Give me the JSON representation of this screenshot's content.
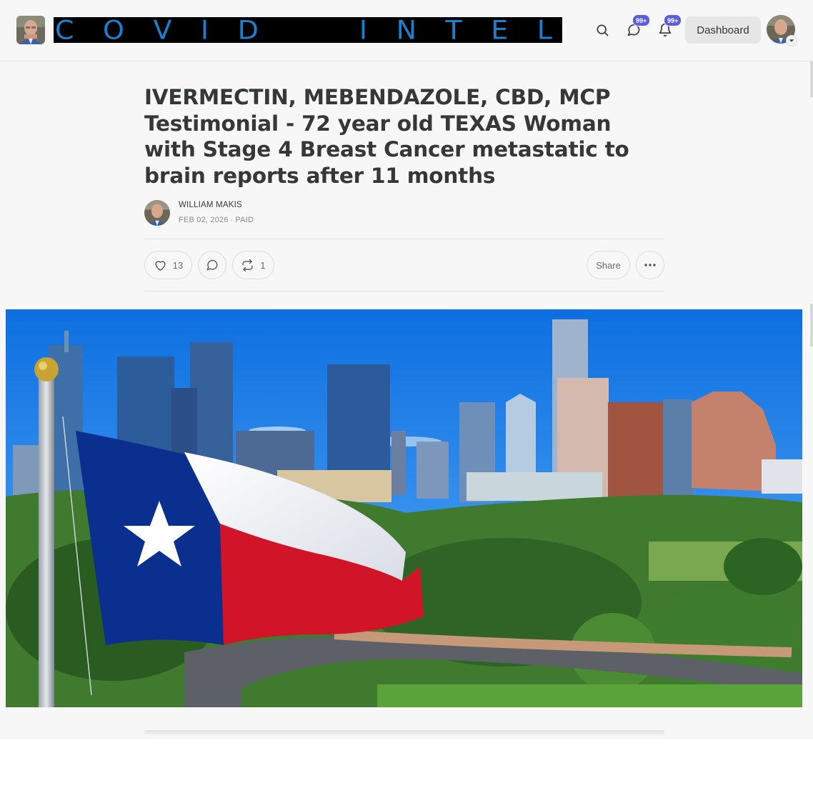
{
  "header": {
    "banner_letters": [
      "C",
      "O",
      "V",
      "I",
      "D",
      "",
      "I",
      "N",
      "T",
      "E",
      "L"
    ],
    "chat_badge": "99+",
    "notifications_badge": "99+",
    "dashboard_label": "Dashboard"
  },
  "post": {
    "title": "IVERMECTIN, MEBENDAZOLE, CBD, MCP Testimonial - 72 year old TEXAS Woman with Stage 4 Breast Cancer metastatic to brain reports after 11 months",
    "author": "WILLIAM MAKIS",
    "meta": "FEB 02, 2026 ∙ PAID",
    "likes": "13",
    "restacks": "1",
    "share_label": "Share"
  },
  "icons": {
    "search": "search-icon",
    "chat": "chat-bubble-icon",
    "bell": "bell-icon",
    "heart": "heart-icon",
    "comment": "comment-icon",
    "restack": "restack-icon",
    "more": "ellipsis-icon",
    "chevron": "chevron-down-icon"
  },
  "colors": {
    "accent_badge": "#5b5fdc",
    "banner_text": "#1d7fd0",
    "texas_blue": "#0a2f8f",
    "texas_red": "#e0162b"
  }
}
